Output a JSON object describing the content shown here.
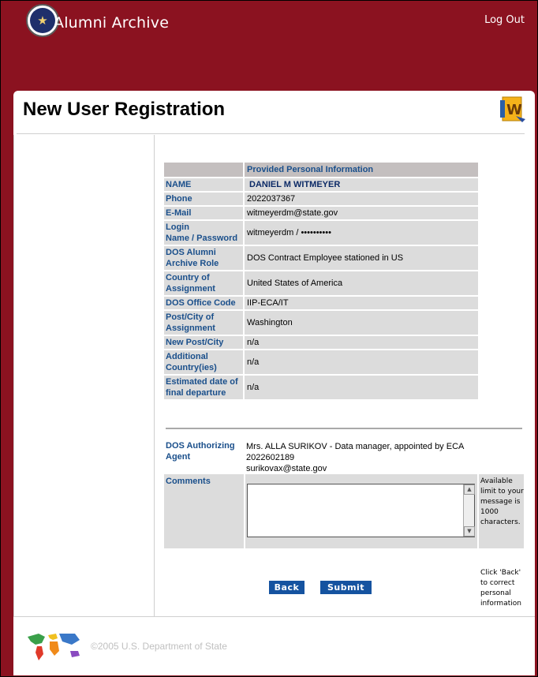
{
  "header": {
    "site_title": "Alumni Archive",
    "logout_label": "Log Out",
    "seal_icon": "us-dept-of-state-seal-icon",
    "brand_color": "#8b1220"
  },
  "page": {
    "title": "New User Registration",
    "corner_icon": "registration-logo-icon"
  },
  "info": {
    "section_header": "Provided Personal Information",
    "rows": [
      {
        "label": "NAME",
        "value": "DANIEL M WITMEYER"
      },
      {
        "label": "Phone",
        "value": "2022037367"
      },
      {
        "label": "E-Mail",
        "value": "witmeyerdm@state.gov"
      },
      {
        "label": "Login\nName / Password",
        "value": "witmeyerdm / ••••••••••"
      },
      {
        "label": "DOS Alumni Archive Role",
        "value": "DOS Contract Employee stationed in US"
      },
      {
        "label": "Country of Assignment",
        "value": "United States of America"
      },
      {
        "label": "DOS Office Code",
        "value": "IIP-ECA/IT"
      },
      {
        "label": "Post/City of Assignment",
        "value": "Washington"
      },
      {
        "label": "New Post/City",
        "value": "n/a"
      },
      {
        "label": "Additional Country(ies)",
        "value": "n/a"
      },
      {
        "label": "Estimated date of final departure",
        "value": "n/a"
      }
    ]
  },
  "authorizing": {
    "label": "DOS Authorizing Agent",
    "line1": "Mrs. ALLA SURIKOV - Data manager, appointed by ECA",
    "line2": "2022602189",
    "line3": "surikovax@state.gov"
  },
  "comments": {
    "label": "Comments",
    "value": "",
    "limit_note": "Available limit to your message is 1000 characters."
  },
  "actions": {
    "back_label": "Back",
    "submit_label": "Submit",
    "back_note": "Click 'Back' to correct personal information"
  },
  "footer": {
    "copyright": "©2005 U.S. Department of State",
    "map_icon": "world-map-icon"
  }
}
